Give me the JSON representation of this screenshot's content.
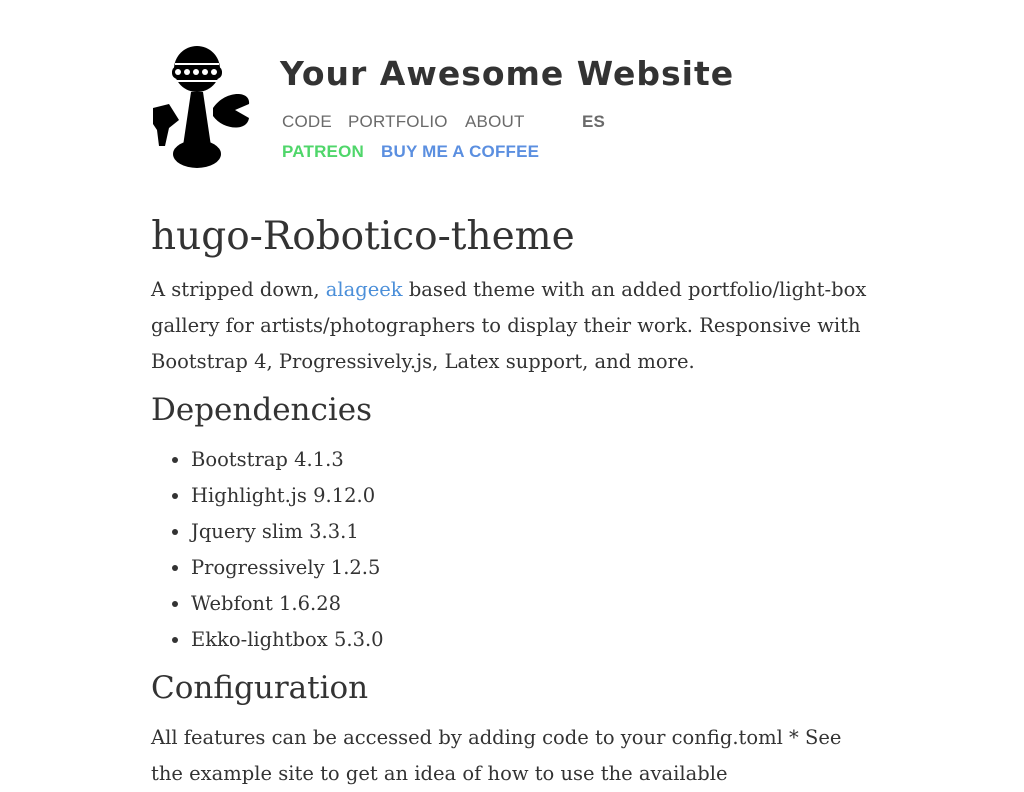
{
  "header": {
    "site_title": "Your Awesome Website",
    "logo_icon": "robot-mascot-icon",
    "nav": {
      "code": "CODE",
      "portfolio": "PORTFOLIO",
      "about": "ABOUT",
      "lang": "ES",
      "patreon": "PATREON",
      "coffee": "BUY ME A COFFEE"
    }
  },
  "colors": {
    "patreon": "#4fd66a",
    "coffee": "#5b8fe0",
    "link": "#4b8fd9",
    "text": "#333333"
  },
  "page": {
    "title": "hugo-Robotico-theme",
    "intro_before": "A stripped down, ",
    "intro_link": "alageek",
    "intro_after": " based theme with an added portfolio/light-box gallery for artists/photographers to display their work. Responsive with Bootstrap 4, Progressively.js, Latex support, and more."
  },
  "dependencies": {
    "heading": "Dependencies",
    "items": [
      "Bootstrap 4.1.3",
      "Highlight.js 9.12.0",
      "Jquery slim 3.3.1",
      "Progressively 1.2.5",
      "Webfont 1.6.28",
      "Ekko-lightbox 5.3.0"
    ]
  },
  "configuration": {
    "heading": "Configuration",
    "text": "All features can be accessed by adding code to your config.toml * See the example site to get an idea of how to use the available"
  }
}
